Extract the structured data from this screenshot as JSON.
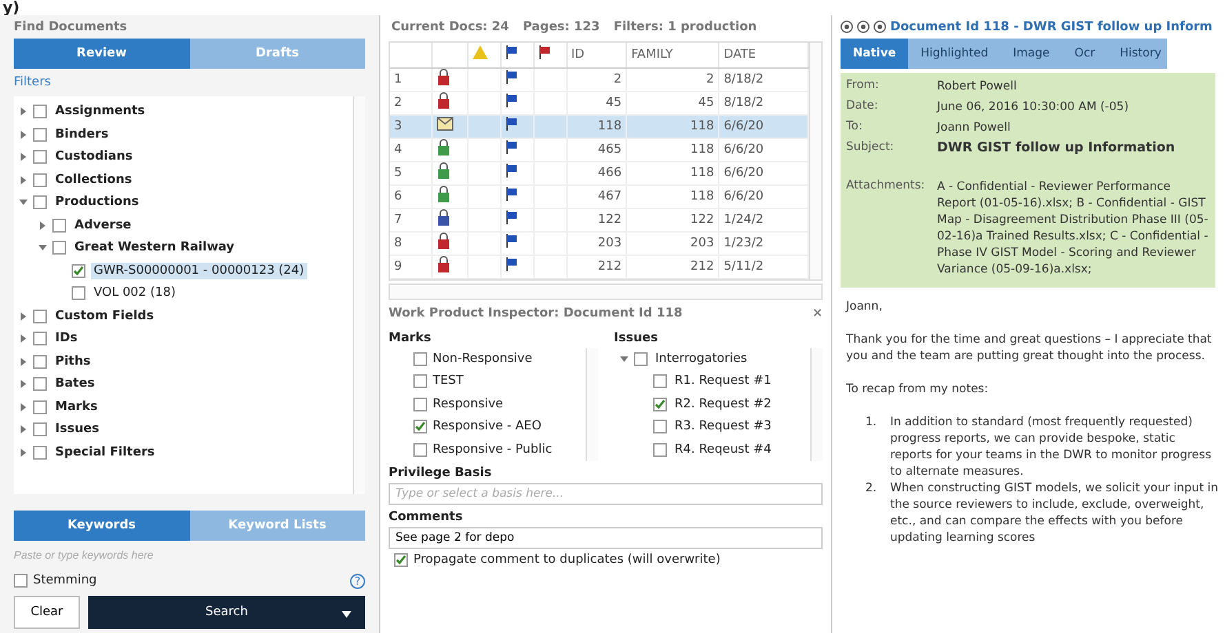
{
  "fragment": "y)",
  "find_panel": {
    "title": "Find Documents",
    "tabs": [
      {
        "label": "Review",
        "selected": true
      },
      {
        "label": "Drafts",
        "selected": false
      }
    ],
    "filters_label": "Filters",
    "tree": [
      {
        "label": "Assignments",
        "checked": false,
        "expanded": false
      },
      {
        "label": "Binders",
        "checked": false,
        "expanded": false
      },
      {
        "label": "Custodians",
        "checked": false,
        "expanded": false
      },
      {
        "label": "Collections",
        "checked": false,
        "expanded": false
      },
      {
        "label": "Productions",
        "checked": false,
        "expanded": true,
        "children": [
          {
            "label": "Adverse",
            "checked": false,
            "expanded": false
          },
          {
            "label": "Great Western Railway",
            "checked": false,
            "expanded": true,
            "children": [
              {
                "label": "GWR-S00000001 - 00000123 (24)",
                "checked": true,
                "selected": true
              },
              {
                "label": "VOL 002 (18)",
                "checked": false,
                "selected": false
              }
            ]
          }
        ]
      },
      {
        "label": "Custom Fields",
        "checked": false,
        "expanded": false
      },
      {
        "label": "IDs",
        "checked": false,
        "expanded": false
      },
      {
        "label": "Piths",
        "checked": false,
        "expanded": false
      },
      {
        "label": "Bates",
        "checked": false,
        "expanded": false
      },
      {
        "label": "Marks",
        "checked": false,
        "expanded": false
      },
      {
        "label": "Issues",
        "checked": false,
        "expanded": false
      },
      {
        "label": "Special Filters",
        "checked": false,
        "expanded": false
      }
    ],
    "keyword_tabs": [
      {
        "label": "Keywords",
        "selected": true
      },
      {
        "label": "Keyword Lists",
        "selected": false
      }
    ],
    "keyword_placeholder": "Paste or type keywords here",
    "stemming": {
      "label": "Stemming",
      "checked": false
    },
    "help": "?",
    "clear": "Clear",
    "search": "Search"
  },
  "results": {
    "summary": [
      "Current Docs: 24",
      "Pages: 123",
      "Filters: 1 production"
    ],
    "columns": [
      "ID",
      "FAMILY",
      "DATE"
    ],
    "rows": [
      {
        "num": "1",
        "kind": "lock_red",
        "id": "2",
        "family": "2",
        "date": "8/18/2",
        "selected": false
      },
      {
        "num": "2",
        "kind": "lock_red",
        "id": "45",
        "family": "45",
        "date": "8/18/2",
        "selected": false
      },
      {
        "num": "3",
        "kind": "email",
        "id": "118",
        "family": "118",
        "date": "6/6/20",
        "selected": true
      },
      {
        "num": "4",
        "kind": "lock_green",
        "id": "465",
        "family": "118",
        "date": "6/6/20",
        "selected": false
      },
      {
        "num": "5",
        "kind": "lock_green",
        "id": "466",
        "family": "118",
        "date": "6/6/20",
        "selected": false
      },
      {
        "num": "6",
        "kind": "lock_green",
        "id": "467",
        "family": "118",
        "date": "6/6/20",
        "selected": false
      },
      {
        "num": "7",
        "kind": "lock_blue",
        "id": "122",
        "family": "122",
        "date": "1/24/2",
        "selected": false
      },
      {
        "num": "8",
        "kind": "lock_red",
        "id": "203",
        "family": "203",
        "date": "1/23/2",
        "selected": false
      },
      {
        "num": "9",
        "kind": "lock_red",
        "id": "212",
        "family": "212",
        "date": "5/11/2",
        "selected": false
      }
    ]
  },
  "inspector": {
    "title": "Work Product Inspector: Document Id 118",
    "close": "×",
    "marks_label": "Marks",
    "marks": [
      {
        "label": "Non-Responsive",
        "checked": false
      },
      {
        "label": "TEST",
        "checked": false
      },
      {
        "label": "Responsive",
        "checked": false
      },
      {
        "label": "Responsive - AEO",
        "checked": true
      },
      {
        "label": "Responsive - Public",
        "checked": false
      }
    ],
    "issues_label": "Issues",
    "issues": [
      {
        "label": "Interrogatories",
        "checked": false,
        "expanded": true,
        "children": [
          {
            "label": "R1. Request #1",
            "checked": false
          },
          {
            "label": "R2. Request #2",
            "checked": true
          },
          {
            "label": "R3. Request #3",
            "checked": false
          },
          {
            "label": "R4. Reqeust #4",
            "checked": false
          }
        ]
      }
    ],
    "privilege_label": "Privilege Basis",
    "privilege_placeholder": "Type or select a basis here...",
    "comments_label": "Comments",
    "comment": "See page 2 for depo",
    "propagate": {
      "label": "Propagate comment to duplicates (will overwrite)",
      "checked": true
    }
  },
  "viewer": {
    "title": "Document Id 118 - DWR GIST follow up Inform",
    "tabs": [
      {
        "label": "Native",
        "selected": true
      },
      {
        "label": "Highlighted",
        "selected": false
      },
      {
        "label": "Image",
        "selected": false
      },
      {
        "label": "Ocr",
        "selected": false
      },
      {
        "label": "History",
        "selected": false
      }
    ],
    "header": [
      {
        "label": "From:",
        "value": "Robert Powell"
      },
      {
        "label": "Date:",
        "value": "June 06, 2016 10:30:00 AM (-05)"
      },
      {
        "label": "To:",
        "value": "Joann Powell"
      },
      {
        "label": "Subject:",
        "value": "DWR GIST follow up Information",
        "kind": "subject"
      },
      {
        "label": "Attachments:",
        "value": "A - Confidential - Reviewer Performance Report (01-05-16).xlsx; B - Confidential - GIST Map - Disagreement Distribution Phase III (05-02-16)a Trained Results.xlsx; C - Confidential - Phase IV GIST Model - Scoring and Reviewer Variance (05-09-16)a.xlsx;",
        "kind": "attachments"
      }
    ],
    "body": [
      "Joann,",
      "Thank you for the time and great questions – I appreciate that you and the team are putting great thought into the process.",
      "To recap from my notes:"
    ],
    "list": [
      {
        "num": "1.",
        "text": "In addition to standard (most frequently requested) progress reports, we can provide bespoke, static reports for your teams in the DWR to monitor progress to alternate measures."
      },
      {
        "num": "2.",
        "text": "When constructing GIST models, we solicit your input in the source reviewers to include, exclude, overweight, etc., and can compare the effects with you before updating learning scores"
      }
    ]
  }
}
